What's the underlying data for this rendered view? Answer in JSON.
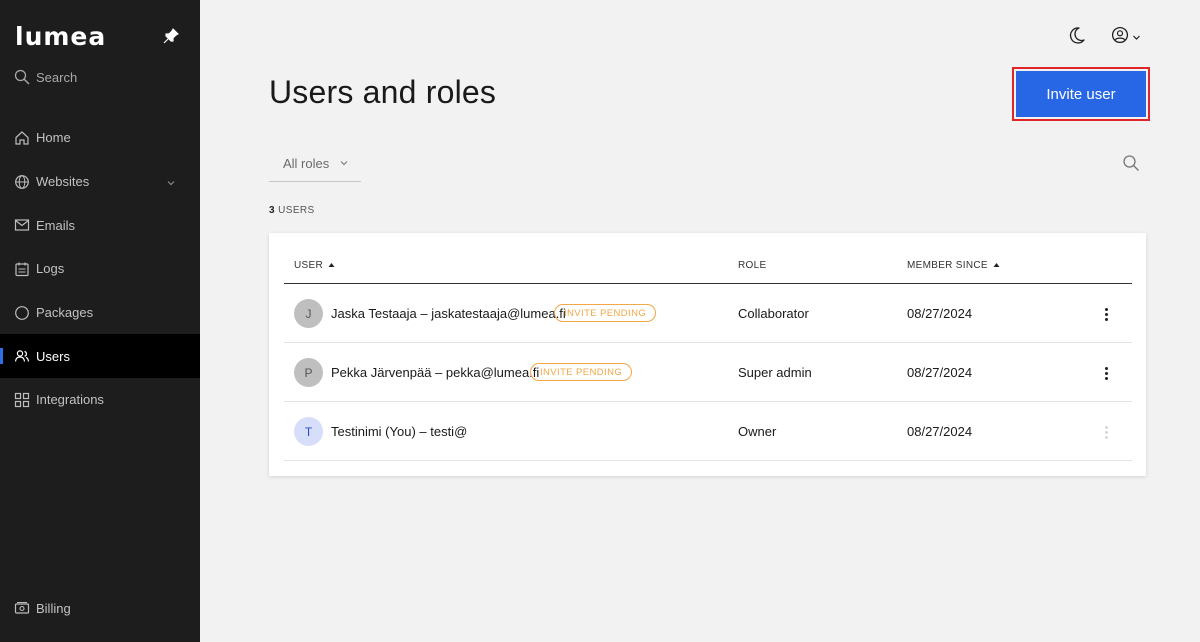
{
  "brand": {
    "logo_text": "lumea"
  },
  "sidebar": {
    "search_label": "Search",
    "items": [
      {
        "label": "Home",
        "icon": "home-icon"
      },
      {
        "label": "Websites",
        "icon": "globe-icon",
        "has_submenu": true
      },
      {
        "label": "Emails",
        "icon": "mail-icon"
      },
      {
        "label": "Logs",
        "icon": "logs-icon"
      },
      {
        "label": "Packages",
        "icon": "package-icon"
      },
      {
        "label": "Users",
        "icon": "users-icon",
        "active": true
      },
      {
        "label": "Integrations",
        "icon": "integrations-icon"
      }
    ],
    "billing_label": "Billing"
  },
  "header": {
    "title": "Users and roles",
    "invite_label": "Invite user"
  },
  "filter": {
    "role_selected": "All roles"
  },
  "summary": {
    "count": "3",
    "count_label": "USERS"
  },
  "table": {
    "columns": {
      "user": "USER",
      "role": "ROLE",
      "member_since": "MEMBER SINCE"
    },
    "rows": [
      {
        "initial": "J",
        "name": "Jaska Testaaja – jaskatestaaja@lumea.fi",
        "badge": "INVITE PENDING",
        "role": "Collaborator",
        "since": "08/27/2024"
      },
      {
        "initial": "P",
        "name": "Pekka Järvenpää – pekka@lumea.fi",
        "badge": "INVITE PENDING",
        "role": "Super admin",
        "since": "08/27/2024"
      },
      {
        "initial": "T",
        "name": "Testinimi  (You) – testi@",
        "badge": "",
        "role": "Owner",
        "since": "08/27/2024"
      }
    ]
  },
  "colors": {
    "accent": "#2766e5",
    "sidebar_bg": "#1d1d1d",
    "badge": "#f0a848",
    "highlight": "#e0252b"
  }
}
